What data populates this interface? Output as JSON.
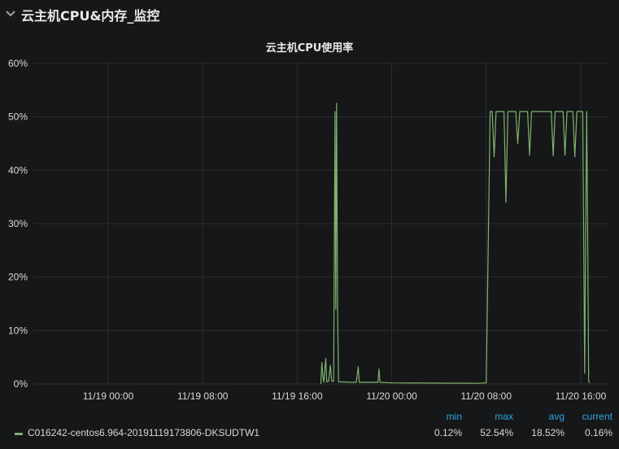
{
  "row": {
    "title": "云主机CPU&内存_监控",
    "collapse_icon": "chevron-down-icon"
  },
  "panel": {
    "title": "云主机CPU使用率"
  },
  "colors": {
    "series": "#7eb26d",
    "grid": "#2c2d30",
    "text": "#d8d9da",
    "legend_header": "#33a2e5",
    "background": "#161719"
  },
  "chart_data": {
    "type": "line",
    "title": "云主机CPU使用率",
    "xlabel": "",
    "ylabel": "",
    "ylim": [
      0,
      60
    ],
    "y_unit": "%",
    "yticks": [
      "0%",
      "10%",
      "20%",
      "30%",
      "40%",
      "50%",
      "60%"
    ],
    "xticks": [
      "11/19 00:00",
      "11/19 08:00",
      "11/19 16:00",
      "11/20 00:00",
      "11/20 08:00",
      "11/20 16:00"
    ],
    "grid": true,
    "legend": "bottom",
    "series": [
      {
        "name": "C016242-centos6.964-20191119173806-DKSUDTW1",
        "points": [
          [
            "11/19 18:00",
            0.0
          ],
          [
            "11/19 18:05",
            4.0
          ],
          [
            "11/19 18:10",
            1.5
          ],
          [
            "11/19 18:15",
            0.3
          ],
          [
            "11/19 18:25",
            4.8
          ],
          [
            "11/19 18:30",
            0.4
          ],
          [
            "11/19 18:40",
            0.5
          ],
          [
            "11/19 18:48",
            3.5
          ],
          [
            "11/19 18:55",
            0.5
          ],
          [
            "11/19 19:05",
            0.5
          ],
          [
            "11/19 19:12",
            51.0
          ],
          [
            "11/19 19:16",
            14.0
          ],
          [
            "11/19 19:20",
            52.54
          ],
          [
            "11/19 19:25",
            14.0
          ],
          [
            "11/19 19:30",
            0.4
          ],
          [
            "11/19 20:30",
            0.3
          ],
          [
            "11/19 21:00",
            0.3
          ],
          [
            "11/19 21:10",
            3.2
          ],
          [
            "11/19 21:15",
            0.3
          ],
          [
            "11/19 22:50",
            0.3
          ],
          [
            "11/19 22:55",
            2.8
          ],
          [
            "11/19 23:00",
            0.3
          ],
          [
            "11/20 00:00",
            0.2
          ],
          [
            "11/20 04:00",
            0.15
          ],
          [
            "11/20 07:30",
            0.12
          ],
          [
            "11/20 08:00",
            0.2
          ],
          [
            "11/20 08:20",
            51.0
          ],
          [
            "11/20 08:30",
            51.0
          ],
          [
            "11/20 08:40",
            42.5
          ],
          [
            "11/20 08:50",
            51.0
          ],
          [
            "11/20 09:30",
            51.0
          ],
          [
            "11/20 09:40",
            34.0
          ],
          [
            "11/20 09:50",
            51.0
          ],
          [
            "11/20 10:30",
            51.0
          ],
          [
            "11/20 10:40",
            45.0
          ],
          [
            "11/20 10:50",
            51.0
          ],
          [
            "11/20 11:30",
            51.0
          ],
          [
            "11/20 11:40",
            42.8
          ],
          [
            "11/20 11:50",
            51.0
          ],
          [
            "11/20 13:30",
            51.0
          ],
          [
            "11/20 13:40",
            42.7
          ],
          [
            "11/20 13:50",
            51.0
          ],
          [
            "11/20 14:30",
            51.0
          ],
          [
            "11/20 14:40",
            42.8
          ],
          [
            "11/20 14:50",
            51.0
          ],
          [
            "11/20 15:20",
            51.0
          ],
          [
            "11/20 15:30",
            42.5
          ],
          [
            "11/20 15:40",
            51.0
          ],
          [
            "11/20 16:10",
            51.0
          ],
          [
            "11/20 16:20",
            2.0
          ],
          [
            "11/20 16:25",
            30.0
          ],
          [
            "11/20 16:30",
            51.0
          ],
          [
            "11/20 16:35",
            28.0
          ],
          [
            "11/20 16:40",
            0.5
          ],
          [
            "11/20 16:45",
            0.16
          ]
        ]
      }
    ],
    "legend_table": {
      "headers": [
        "min",
        "max",
        "avg",
        "current"
      ],
      "rows": [
        {
          "name": "C016242-centos6.964-20191119173806-DKSUDTW1",
          "min": "0.12%",
          "max": "52.54%",
          "avg": "18.52%",
          "current": "0.16%"
        }
      ]
    }
  }
}
